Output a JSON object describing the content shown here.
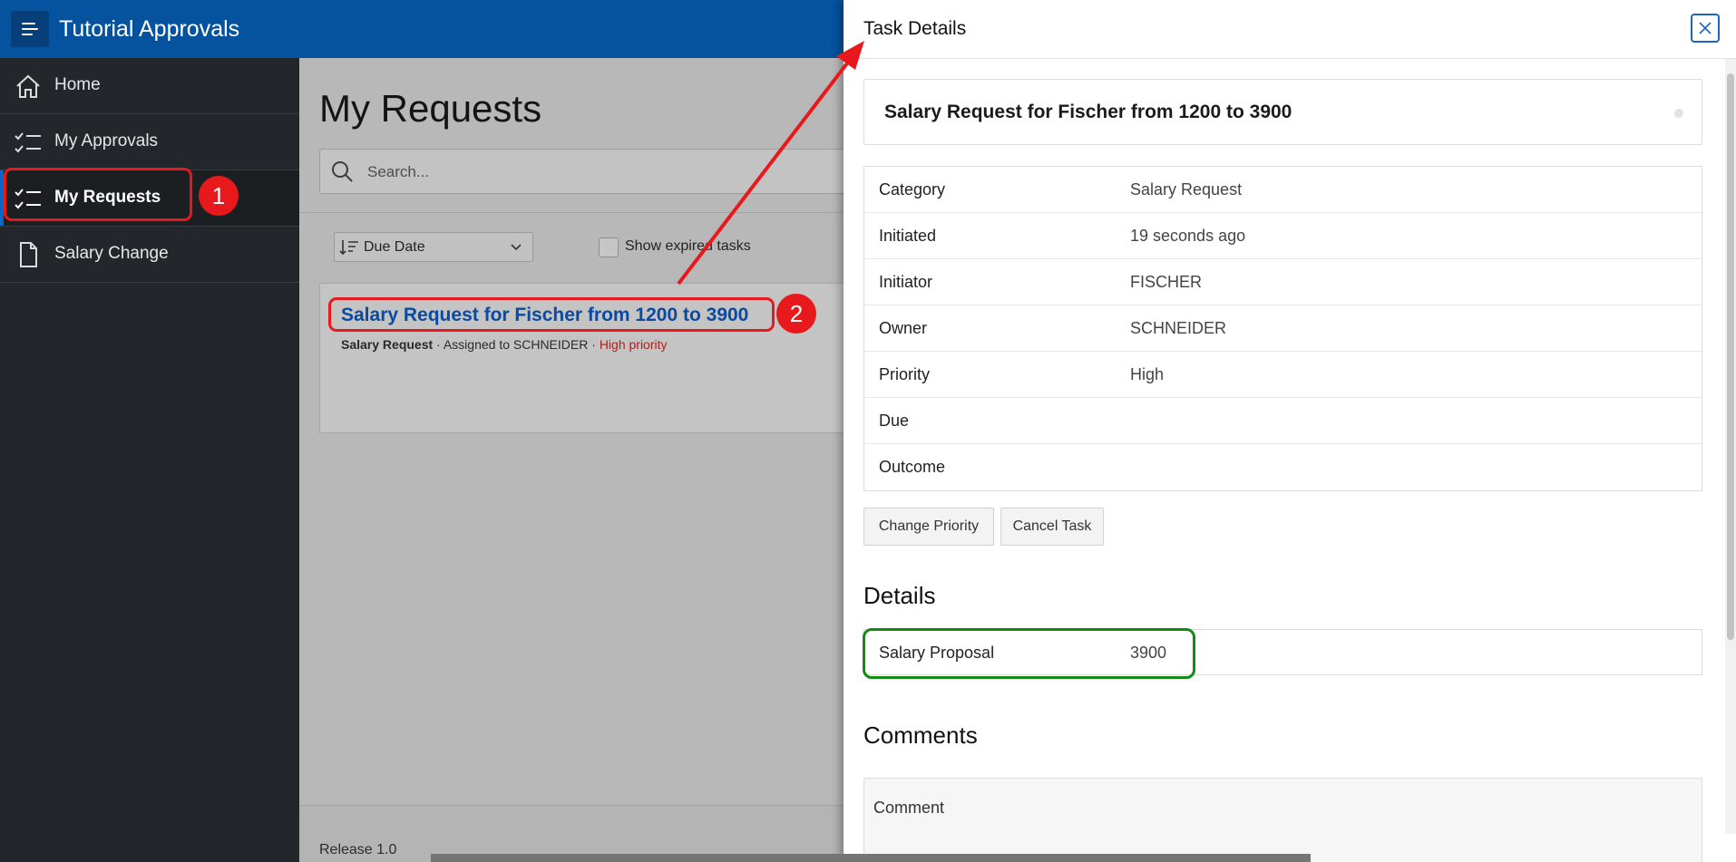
{
  "header": {
    "app_title": "Tutorial Approvals"
  },
  "sidebar": {
    "items": [
      {
        "label": "Home",
        "icon": "home-icon"
      },
      {
        "label": "My Approvals",
        "icon": "checklist-icon"
      },
      {
        "label": "My Requests",
        "icon": "checklist-icon",
        "active": true
      },
      {
        "label": "Salary Change",
        "icon": "document-icon"
      }
    ]
  },
  "main": {
    "page_title": "My Requests",
    "search_placeholder": "Search...",
    "sort_label": "Due Date",
    "show_expired_label": "Show expired tasks",
    "task": {
      "title": "Salary Request for Fischer from 1200 to 3900",
      "category": "Salary Request",
      "assigned": "Assigned to SCHNEIDER",
      "priority": "High priority",
      "separator": " · "
    },
    "release": "Release 1.0"
  },
  "drawer": {
    "title": "Task Details",
    "summary_title": "Salary Request for Fischer from 1200 to 3900",
    "properties": [
      {
        "label": "Category",
        "value": "Salary Request"
      },
      {
        "label": "Initiated",
        "value": "19 seconds ago"
      },
      {
        "label": "Initiator",
        "value": "FISCHER"
      },
      {
        "label": "Owner",
        "value": "SCHNEIDER"
      },
      {
        "label": "Priority",
        "value": "High"
      },
      {
        "label": "Due",
        "value": ""
      },
      {
        "label": "Outcome",
        "value": ""
      }
    ],
    "buttons": {
      "change_priority": "Change Priority",
      "cancel_task": "Cancel Task"
    },
    "details_heading": "Details",
    "details": {
      "label": "Salary Proposal",
      "value": "3900"
    },
    "comments_heading": "Comments",
    "comment_label": "Comment"
  },
  "annotations": {
    "step1": "1",
    "step2": "2"
  },
  "colors": {
    "header_blue": "#05529f",
    "annotation_red": "#e8191c",
    "annotation_green": "#138a13",
    "link_blue": "#0a4aa0",
    "priority_red": "#b01e1e"
  }
}
